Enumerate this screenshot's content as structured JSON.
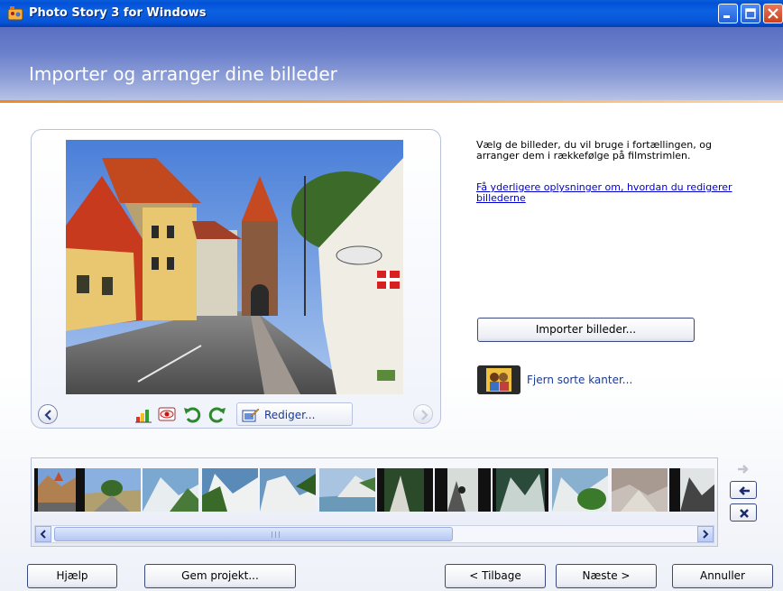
{
  "window": {
    "title": "Photo Story 3 for Windows"
  },
  "header": {
    "heading": "Importer og arranger dine billeder"
  },
  "preview": {
    "edit_label": "Rediger..."
  },
  "right_panel": {
    "instructions": "Vælg de billeder, du vil bruge i fortællingen, og arranger dem i rækkefølge på filmstrimlen.",
    "help_link": "Få yderligere oplysninger om, hvordan du redigerer billederne",
    "import_button": "Importer billeder...",
    "remove_borders_link": "Fjern sorte kanter..."
  },
  "footer": {
    "help": "Hjælp",
    "save_project": "Gem projekt...",
    "back": "< Tilbage",
    "next": "Næste >",
    "cancel": "Annuller"
  },
  "colors": {
    "titlebar": "#0a5fd8",
    "header": "#6b80cc",
    "accent_line": "#f08a20",
    "link": "#0000cc"
  },
  "icons": [
    "photo-story-app-icon",
    "minimize-icon",
    "maximize-icon",
    "close-icon",
    "previous-icon",
    "next-icon",
    "auto-fix-icon",
    "red-eye-icon",
    "rotate-left-icon",
    "rotate-right-icon",
    "edit-icon",
    "remove-borders-icon",
    "move-right-icon",
    "move-left-icon",
    "delete-icon"
  ]
}
